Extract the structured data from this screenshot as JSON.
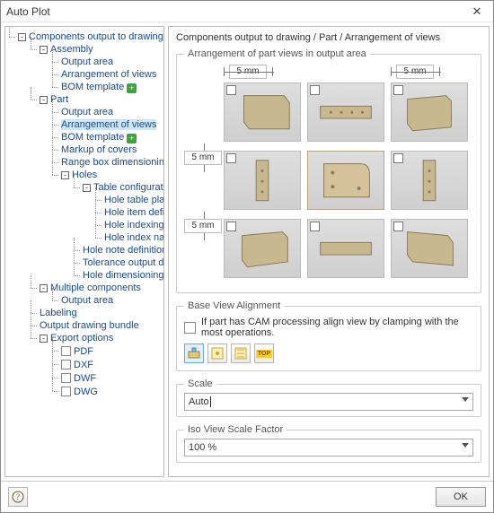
{
  "window": {
    "title": "Auto Plot",
    "close": "✕"
  },
  "breadcrumb": "Components output to drawing / Part / Arrangement of views",
  "tree": {
    "root": "Components output to drawing",
    "assembly": "Assembly",
    "assembly_output_area": "Output area",
    "assembly_arrangement": "Arrangement of views",
    "assembly_bom": "BOM template",
    "part": "Part",
    "part_output_area": "Output area",
    "part_arrangement": "Arrangement of views",
    "part_bom": "BOM template",
    "part_markup": "Markup of covers",
    "part_rangebox": "Range box dimensioning",
    "holes": "Holes",
    "table_config": "Table configuration",
    "hole_table_placement": "Hole table placement",
    "hole_item_def": "Hole item definition",
    "hole_indexing": "Hole indexing by side a",
    "hole_index_name": "Hole index name reser",
    "hole_note_def": "Hole note definition",
    "tolerance_output": "Tolerance output definitio",
    "hole_dimensioning": "Hole dimensioning",
    "multiple_components": "Multiple components",
    "multi_output_area": "Output area",
    "labeling": "Labeling",
    "output_bundle": "Output drawing bundle",
    "export_options": "Export options",
    "pdf": "PDF",
    "dxf": "DXF",
    "dwf": "DWF",
    "dwg": "DWG"
  },
  "group": {
    "arrangement_title": "Arrangement of part views in output area",
    "base_view_title": "Base View Alignment",
    "scale_title": "Scale",
    "iso_title": "Iso View Scale Factor"
  },
  "margins": {
    "top_left": "5 mm",
    "top_right": "5 mm",
    "left_upper": "5 mm",
    "left_lower": "5 mm"
  },
  "base_view": {
    "checkbox_label": "If part has CAM processing align view by clamping with the most operations.",
    "icon_top_label": "TOP"
  },
  "scale": {
    "value": "Auto"
  },
  "iso": {
    "value": "100 %"
  },
  "footer": {
    "ok": "OK"
  }
}
